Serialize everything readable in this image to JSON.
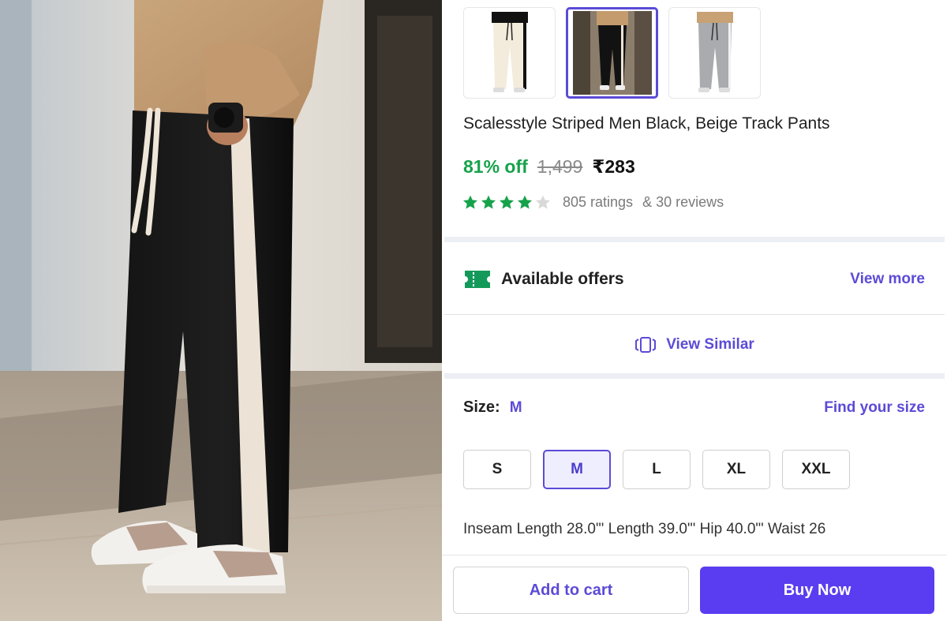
{
  "product": {
    "title": "Scalesstyle Striped Men Black, Beige Track Pants",
    "discount": "81% off",
    "mrp": "1,499",
    "price": "₹283",
    "rating": {
      "stars_filled": 4,
      "stars_total": 5,
      "ratings_text": "805 ratings",
      "reviews_text": "& 30 reviews"
    }
  },
  "thumbnails": [
    {
      "name": "white-track-pants",
      "selected": false
    },
    {
      "name": "black-track-pants",
      "selected": true
    },
    {
      "name": "grey-track-pants",
      "selected": false
    }
  ],
  "offers": {
    "icon": "ticket-icon",
    "label": "Available offers",
    "link": "View more"
  },
  "similar": {
    "icon": "similar-products-icon",
    "label": "View Similar"
  },
  "size": {
    "label": "Size:",
    "selected": "M",
    "guide_link": "Find your size",
    "options": [
      "S",
      "M",
      "L",
      "XL",
      "XXL"
    ],
    "measurements": "Inseam Length 28.0\"'  Length 39.0\"'  Hip 40.0\"'  Waist 26"
  },
  "actions": {
    "add_to_cart": "Add to cart",
    "buy_now": "Buy Now"
  },
  "colors": {
    "accent": "#5b4bd6",
    "buy_button": "#5a3df0",
    "discount": "#16a24b",
    "star": "#16a24b"
  }
}
